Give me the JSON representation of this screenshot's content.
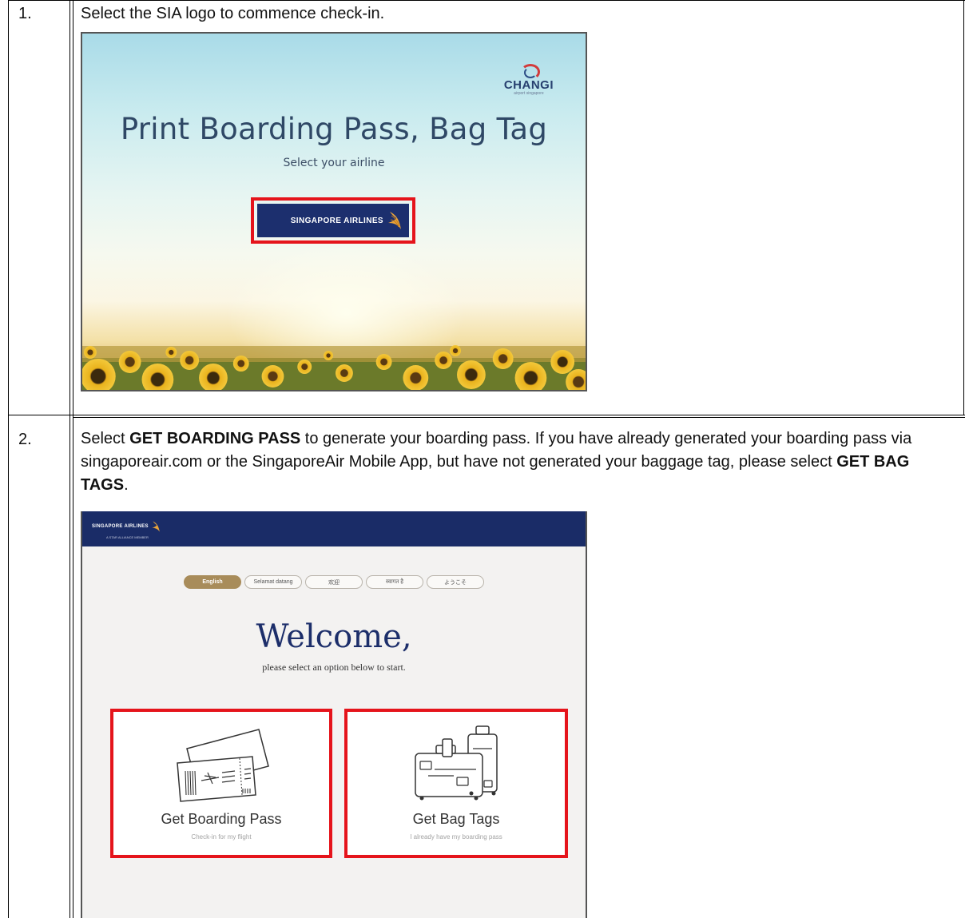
{
  "rows": [
    {
      "number": "1.",
      "instruction": "Select the SIA logo to commence check-in."
    },
    {
      "number": "2.",
      "instruction_parts": [
        "Select ",
        "GET BOARDING PASS",
        " to generate your boarding pass. If you have already generated your boarding pass via singaporeair.com or the SingaporeAir Mobile App, but have not generated your baggage tag, please select ",
        "GET BAG TAGS",
        "."
      ]
    }
  ],
  "screen1": {
    "brand": "CHANGI",
    "brand_sub": "airport singapore",
    "title": "Print Boarding Pass, Bag Tag",
    "subtitle": "Select your airline",
    "airline_logo_text": "SINGAPORE AIRLINES"
  },
  "screen2": {
    "header_logo": "SINGAPORE AIRLINES",
    "header_alliance": "A STAR ALLIANCE MEMBER",
    "languages": [
      "English",
      "Selamat datang",
      "欢迎",
      "स्वागत है",
      "ようこそ"
    ],
    "active_language": "English",
    "welcome": "Welcome,",
    "welcome_sub": "please select an option below to start.",
    "options": [
      {
        "title": "Get Boarding Pass",
        "subtitle": "Check-in for my flight"
      },
      {
        "title": "Get Bag Tags",
        "subtitle": "I already have my boarding pass"
      }
    ]
  },
  "colors": {
    "highlight": "#e5141b",
    "sia_navy": "#1a2c67",
    "sia_gold": "#a88c5a",
    "changi_blue": "#27406f"
  }
}
